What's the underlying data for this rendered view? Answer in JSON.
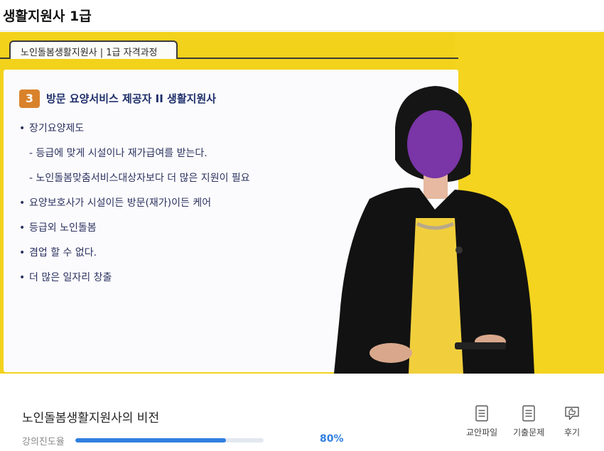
{
  "app": {
    "title": "생활지원사 1급"
  },
  "video": {
    "course_tab": "노인돌봄생활지원사 | 1급 자격과정",
    "slide": {
      "number": "3",
      "heading": "방문 요양서비스 제공자 II  생활지원사",
      "bullets": [
        "장기요양제도",
        "- 등급에 맞게 시설이나 재가급여를 받는다.",
        "- 노인돌봄맞춤서비스대상자보다 더 많은 지원이 필요",
        "요양보호사가 시설이든 방문(재가)이든 케어",
        "등급외 노인돌봄",
        "겸업 할 수 없다.",
        "더 많은 일자리 창출"
      ]
    }
  },
  "lesson": {
    "title": "노인돌봄생활지원사의 비전",
    "progress_label": "강의진도율",
    "progress_value": "80%",
    "progress_fraction": 0.8
  },
  "actions": [
    {
      "label": "교안파일",
      "icon": "document-icon"
    },
    {
      "label": "기출문제",
      "icon": "document-icon"
    },
    {
      "label": "후기",
      "icon": "thumbs-up-icon"
    }
  ],
  "colors": {
    "accent": "#2f7fe0",
    "video_bg": "#f3d21c",
    "slide_number_bg": "#d9822b",
    "heading_text": "#1f2f6b"
  }
}
